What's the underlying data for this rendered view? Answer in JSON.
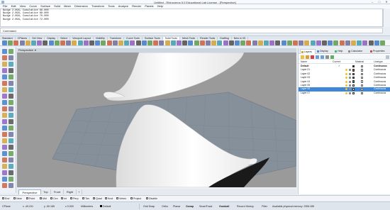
{
  "window": {
    "title": "Untitled - Rhinoceros 5.0 Educational Lab License - [Perspective]",
    "controls": [
      "–",
      "□",
      "✕"
    ]
  },
  "menu": [
    "File",
    "Edit",
    "View",
    "Curve",
    "Surface",
    "Solid",
    "Mesh",
    "Dimension",
    "Transform",
    "Tools",
    "Analyze",
    "Render",
    "Panels",
    "Help"
  ],
  "history": [
    "Nudge 2.096, Cumulative 66.000",
    "Nudge 2.096, Cumulative 68.000",
    "Nudge 2.096, Cumulative 70.000",
    "Nudge 2.096, Cumulative 72.000"
  ],
  "command_prompt": "Command:",
  "toolbar_tabs": [
    "Standard",
    "CPlanes",
    "Set View",
    "Display",
    "Select",
    "Viewport Layout",
    "Visibility",
    "Transform",
    "Curve Tools",
    "Surface Tools",
    "Solid Tools",
    "Mesh Tools",
    "Render Tools",
    "Drafting",
    "New in V5"
  ],
  "active_toolbar_tab": "Solid Tools",
  "viewport": {
    "label": "Perspective",
    "tabs": [
      "Perspective",
      "Top",
      "Front",
      "Right"
    ],
    "add_tab": "+"
  },
  "osnaps": [
    "End",
    "Near",
    "Point",
    "Mid",
    "Cen",
    "Int",
    "Perp",
    "Tan",
    "Quad",
    "Knot",
    "Vertex",
    "Project",
    "Disable"
  ],
  "status": {
    "plane": "CPlane",
    "x": "x -49.241",
    "y": "y -50.185",
    "z": "z 0.000",
    "units": "Millimeters",
    "layer": "Default",
    "toggles": [
      "Grid Snap",
      "Ortho",
      "Planar",
      "Osnap",
      "SmartTrack",
      "Gumball",
      "Record History",
      "Filter"
    ],
    "memory": "Available physical memory: 2954 MB"
  },
  "panel": {
    "tabs": [
      "Layers",
      "Display",
      "Help",
      "Calculator",
      "Properties"
    ],
    "columns": [
      "Name",
      "Current",
      "Material",
      "Linetype"
    ],
    "layers": [
      {
        "name": "Default",
        "current": "✓",
        "linetype": "Continuous",
        "color": "#000000",
        "bold": true
      },
      {
        "name": "Layer 01",
        "current": "",
        "linetype": "Continuous",
        "color": "#e03030",
        "bold": false
      },
      {
        "name": "Layer 02",
        "current": "",
        "linetype": "Continuous",
        "color": "#8c5ad8",
        "bold": false
      },
      {
        "name": "Layer 03",
        "current": "",
        "linetype": "Continuous",
        "color": "#2a6fd6",
        "bold": false
      },
      {
        "name": "Layer 04",
        "current": "",
        "linetype": "Continuous",
        "color": "#20a050",
        "bold": false
      },
      {
        "name": "Layer 05",
        "current": "",
        "linetype": "Continuous",
        "color": "#ffffff",
        "bold": false
      },
      {
        "name": "Layer 06",
        "current": "",
        "linetype": "Continuous",
        "color": "#ffffff",
        "bold": false,
        "selected": true
      },
      {
        "name": "Layer 07",
        "current": "",
        "linetype": "Continuous",
        "color": "#ffffff",
        "bold": false
      }
    ]
  },
  "colors": {
    "accent": "#3e87d6",
    "viewport_bg": "#9a9a9a",
    "grid_plane": "#7f8a96"
  }
}
